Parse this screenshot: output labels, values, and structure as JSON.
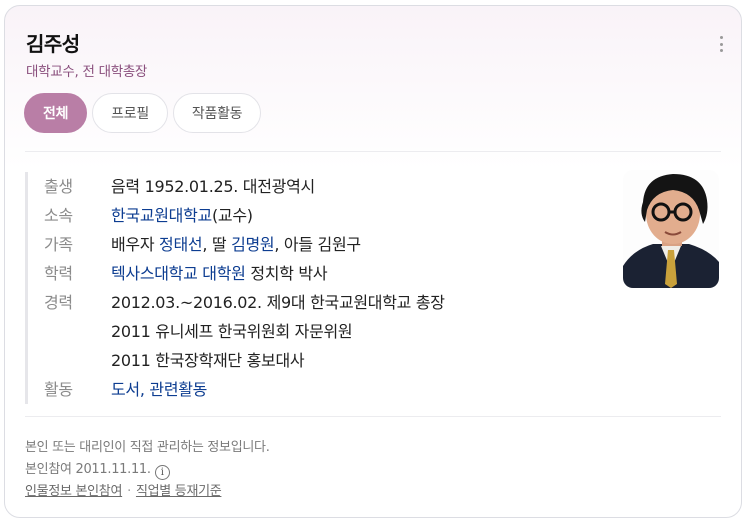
{
  "profile": {
    "name": "김주성",
    "occupation": "대학교수, 전 대학총장"
  },
  "menu": {
    "icon": "more-vertical-icon"
  },
  "tabs": [
    {
      "label": "전체",
      "active": true
    },
    {
      "label": "프로필",
      "active": false
    },
    {
      "label": "작품활동",
      "active": false
    }
  ],
  "info": {
    "birth": {
      "label": "출생",
      "value": "음력 1952.01.25. 대전광역시"
    },
    "affiliation": {
      "label": "소속",
      "link": "한국교원대학교",
      "suffix": "(교수)"
    },
    "family": {
      "label": "가족",
      "prefix": "배우자 ",
      "spouse": "정태선",
      "mid": ", 딸 ",
      "daughter": "김명원",
      "suffix": ", 아들 김원구"
    },
    "education": {
      "label": "학력",
      "link": "텍사스대학교 대학원",
      "suffix": " 정치학 박사"
    },
    "career": {
      "label": "경력",
      "items": [
        "2012.03.~2016.02. 제9대 한국교원대학교 총장",
        "2011 유니세프 한국위원회 자문위원",
        "2011 한국장학재단 홍보대사"
      ]
    },
    "activity": {
      "label": "활동",
      "link1": "도서",
      "sep": ", ",
      "link2": "관련활동"
    }
  },
  "photo": {
    "alt": "김주성 프로필 사진"
  },
  "footer": {
    "notice": "본인 또는 대리인이 직접 관리하는 정보입니다.",
    "date_text": "본인참여 2011.11.11.",
    "info_icon": "i",
    "link1": "인물정보 본인참여",
    "separator": "·",
    "link2": "직업별 등재기준"
  },
  "colors": {
    "accent": "#b97ea6",
    "occupation": "#8a4f7d",
    "link": "#0d3d91"
  }
}
